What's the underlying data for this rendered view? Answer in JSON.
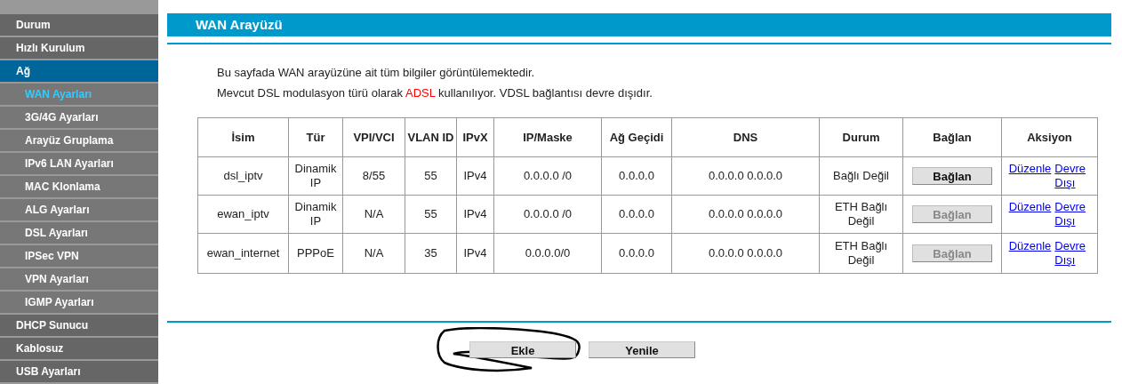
{
  "sidebar": {
    "items": [
      {
        "label": "Durum",
        "selected": false
      },
      {
        "label": "Hızlı Kurulum",
        "selected": false
      },
      {
        "label": "Ağ",
        "selected": true,
        "children": [
          {
            "label": "WAN Ayarları",
            "selected": true
          },
          {
            "label": "3G/4G Ayarları",
            "selected": false
          },
          {
            "label": "Arayüz Gruplama",
            "selected": false
          },
          {
            "label": "IPv6 LAN Ayarları",
            "selected": false
          },
          {
            "label": "MAC Klonlama",
            "selected": false
          },
          {
            "label": "ALG Ayarları",
            "selected": false
          },
          {
            "label": "DSL Ayarları",
            "selected": false
          },
          {
            "label": "IPSec VPN",
            "selected": false
          },
          {
            "label": "VPN Ayarları",
            "selected": false
          },
          {
            "label": "IGMP Ayarları",
            "selected": false
          }
        ]
      },
      {
        "label": "DHCP Sunucu",
        "selected": false
      },
      {
        "label": "Kablosuz",
        "selected": false
      },
      {
        "label": "USB Ayarları",
        "selected": false
      }
    ]
  },
  "page_title": "WAN Arayüzü",
  "description": "Bu sayfada WAN arayüzüne ait tüm bilgiler görüntülemektedir.",
  "notice": [
    {
      "text": "Mevcut DSL modulasyon türü olarak ",
      "highlight": false
    },
    {
      "text": "ADSL",
      "highlight": true
    },
    {
      "text": " kullanılıyor. VDSL bağlantısı devre dışıdır.",
      "highlight": false
    }
  ],
  "table": {
    "columns": [
      "İsim",
      "Tür",
      "VPI/VCI",
      "VLAN ID",
      "IPvX",
      "IP/Maske",
      "Ağ Geçidi",
      "DNS",
      "Durum",
      "Bağlan",
      "Aksiyon"
    ],
    "rows": [
      {
        "cells": [
          "dsl_iptv",
          "Dinamik IP",
          "8/55",
          "55",
          "IPv4",
          "0.0.0.0 /0",
          "0.0.0.0",
          "0.0.0.0 0.0.0.0",
          "Bağlı Değil"
        ],
        "connect": {
          "label": "Bağlan",
          "disabled": false
        },
        "actions": [
          "Düzenle",
          "Devre Dışı"
        ]
      },
      {
        "cells": [
          "ewan_iptv",
          "Dinamik IP",
          "N/A",
          "55",
          "IPv4",
          "0.0.0.0 /0",
          "0.0.0.0",
          "0.0.0.0 0.0.0.0",
          "ETH Bağlı Değil"
        ],
        "connect": {
          "label": "Bağlan",
          "disabled": true
        },
        "actions": [
          "Düzenle",
          "Devre Dışı"
        ]
      },
      {
        "cells": [
          "ewan_internet",
          "PPPoE",
          "N/A",
          "35",
          "IPv4",
          "0.0.0.0/0",
          "0.0.0.0",
          "0.0.0.0 0.0.0.0",
          "ETH Bağlı Değil"
        ],
        "connect": {
          "label": "Bağlan",
          "disabled": true
        },
        "actions": [
          "Düzenle",
          "Devre Dışı"
        ]
      }
    ]
  },
  "buttons": [
    {
      "label": "Ekle",
      "circled": true
    },
    {
      "label": "Yenile",
      "circled": false
    }
  ]
}
